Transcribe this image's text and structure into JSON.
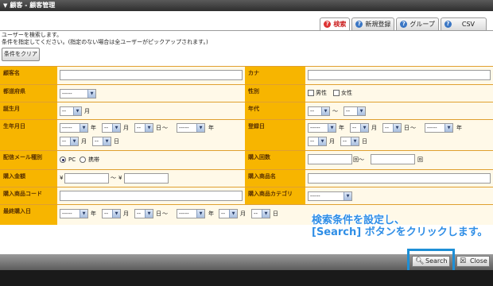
{
  "window": {
    "title": "顧客 - 顧客管理"
  },
  "tabs": [
    {
      "label": "検索",
      "icon": "help-icon",
      "active": true
    },
    {
      "label": "新規登録",
      "icon": "help-icon"
    },
    {
      "label": "グループ",
      "icon": "help-icon"
    },
    {
      "label": "CSV",
      "icon": "help-icon"
    }
  ],
  "description": {
    "line1": "ユーザーを検索します。",
    "line2": "条件を指定してください。(指定のない場合は全ユーザーがピックアップされます。)"
  },
  "clear_button": "条件をクリア",
  "fields": {
    "name": "顧客名",
    "kana": "カナ",
    "pref": "都道府県",
    "pref_value": "-----",
    "gender": "性別",
    "male": "男性",
    "female": "女性",
    "birth_month": "誕生月",
    "birth_month_value": "--",
    "month_unit": "月",
    "age": "年代",
    "age_from": "--",
    "age_to": "--",
    "tilde": "～",
    "birthdate": "生年月日",
    "registered": "登録日",
    "year_value": "-----",
    "md_value": "--",
    "year_unit": "年",
    "day_unit": "日",
    "mail_type": "配信メール種別",
    "pc": "PC",
    "mobile": "携帯",
    "purchase_count": "購入回数",
    "count_unit": "回",
    "purchase_amount": "購入金額",
    "yen": "¥",
    "purchase_product": "購入商品名",
    "product_code": "購入商品コード",
    "product_category": "購入商品カテゴリ",
    "category_value": "-----",
    "last_purchase": "最終購入日"
  },
  "annotation": {
    "line1": "検索条件を設定し、",
    "line2": "[Search] ボタンをクリックします。"
  },
  "buttons": {
    "search": "Search",
    "close": "Close"
  }
}
